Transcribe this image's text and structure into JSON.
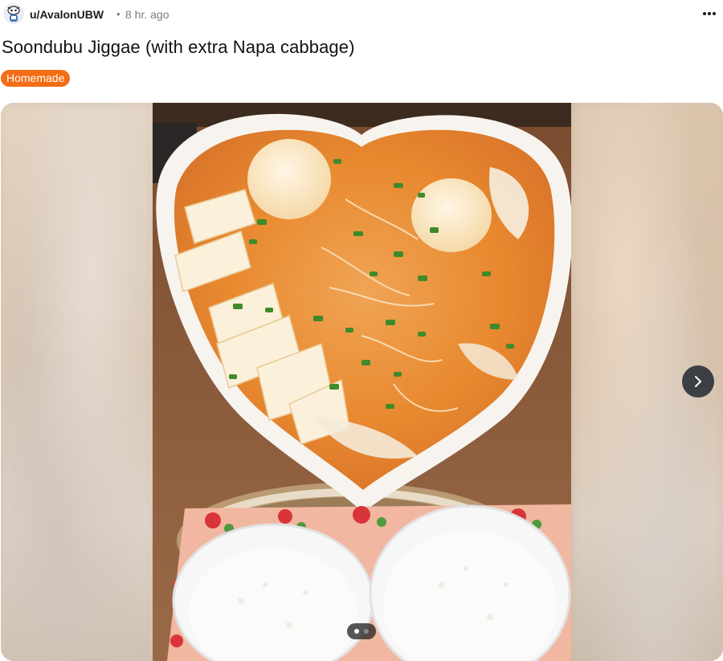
{
  "post": {
    "author": "u/AvalonUBW",
    "separator": "•",
    "age": "8 hr. ago",
    "title": "Soondubu Jiggae (with extra Napa cabbage)",
    "flair": "Homemade",
    "flair_color": "#f26d14"
  },
  "icons": {
    "avatar": "snoo-avatar-icon",
    "more": "more-options-icon",
    "next": "chevron-right-icon"
  },
  "gallery": {
    "total_images": 2,
    "current_index": 1
  }
}
